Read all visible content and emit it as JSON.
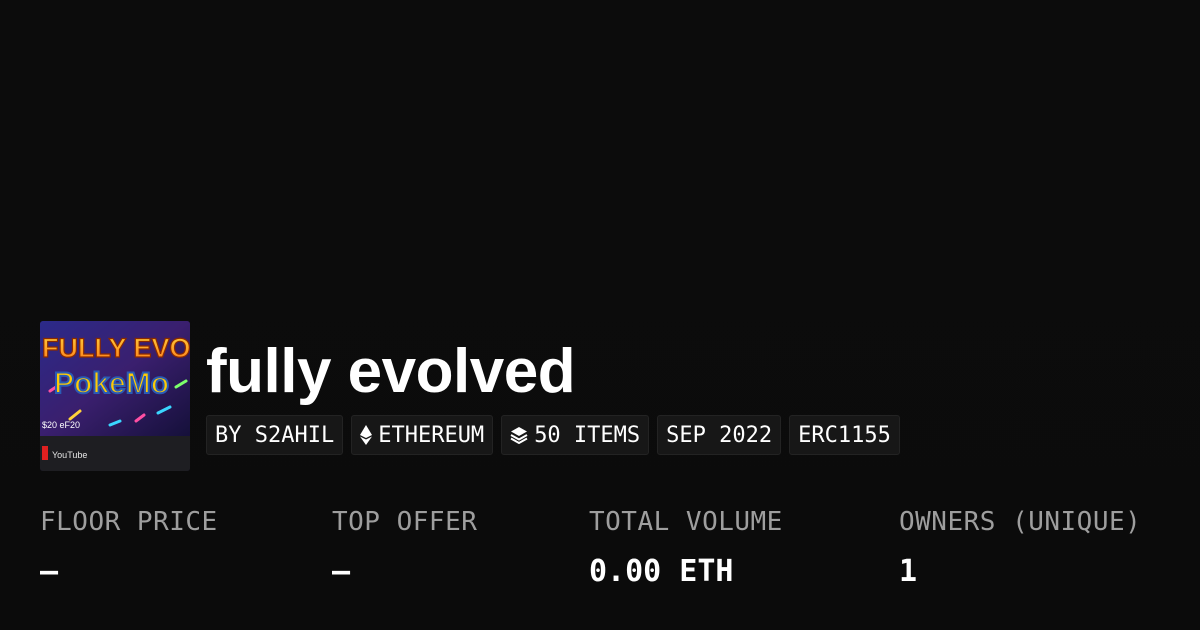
{
  "collection": {
    "title": "fully evolved",
    "thumbnail": {
      "icon": "collection-thumbnail",
      "headline": "FULLY EVOL",
      "subline": "PokeMo",
      "caption": "$20 eF20",
      "footer": "YouTube"
    }
  },
  "tags": {
    "creator": "BY S2AHIL",
    "chain": "ETHEREUM",
    "chain_icon": "ethereum-icon",
    "items": "50 ITEMS",
    "items_icon": "layers-icon",
    "date": "SEP 2022",
    "standard": "ERC1155"
  },
  "stats": {
    "floor_price": {
      "label": "FLOOR PRICE",
      "value": "–"
    },
    "top_offer": {
      "label": "TOP OFFER",
      "value": "–"
    },
    "total_volume": {
      "label": "TOTAL VOLUME",
      "value": "0.00 ETH"
    },
    "owners": {
      "label": "OWNERS (UNIQUE)",
      "value": "1"
    }
  },
  "colors": {
    "background": "#0b0b0b",
    "tag_background": "#171717",
    "label_gray": "#9e9e9e",
    "text": "#ffffff"
  }
}
